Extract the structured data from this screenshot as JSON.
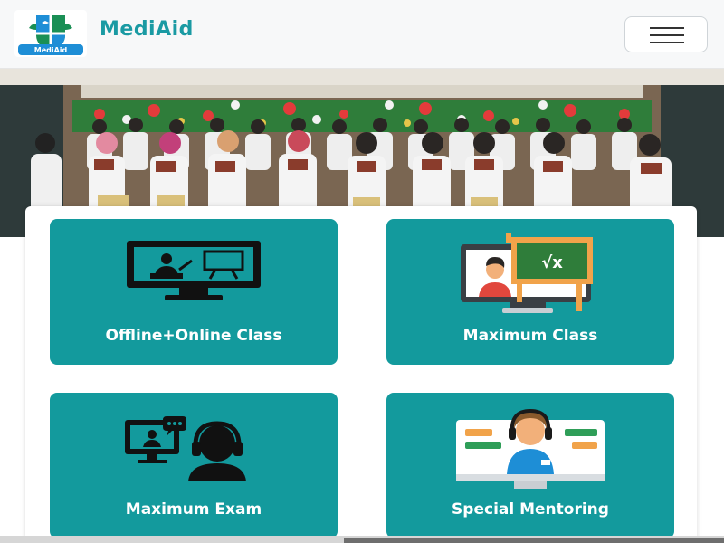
{
  "header": {
    "brand": "MediAid",
    "logo_text": "MediAid",
    "menu_icon": "hamburger-menu-icon"
  },
  "hero": {
    "image": "group-photo-of-students-in-white-coats-holding-certificates"
  },
  "features": [
    {
      "label": "Offline+Online Class",
      "icon": "teacher-screen-icon"
    },
    {
      "label": "Maximum Class",
      "icon": "online-lecture-icon"
    },
    {
      "label": "Maximum Exam",
      "icon": "exam-support-icon"
    },
    {
      "label": "Special Mentoring",
      "icon": "mentor-headset-icon"
    }
  ],
  "colors": {
    "brand": "#1a9aa3",
    "card": "#139a9d",
    "navbar_bg": "#f7f8f9"
  }
}
